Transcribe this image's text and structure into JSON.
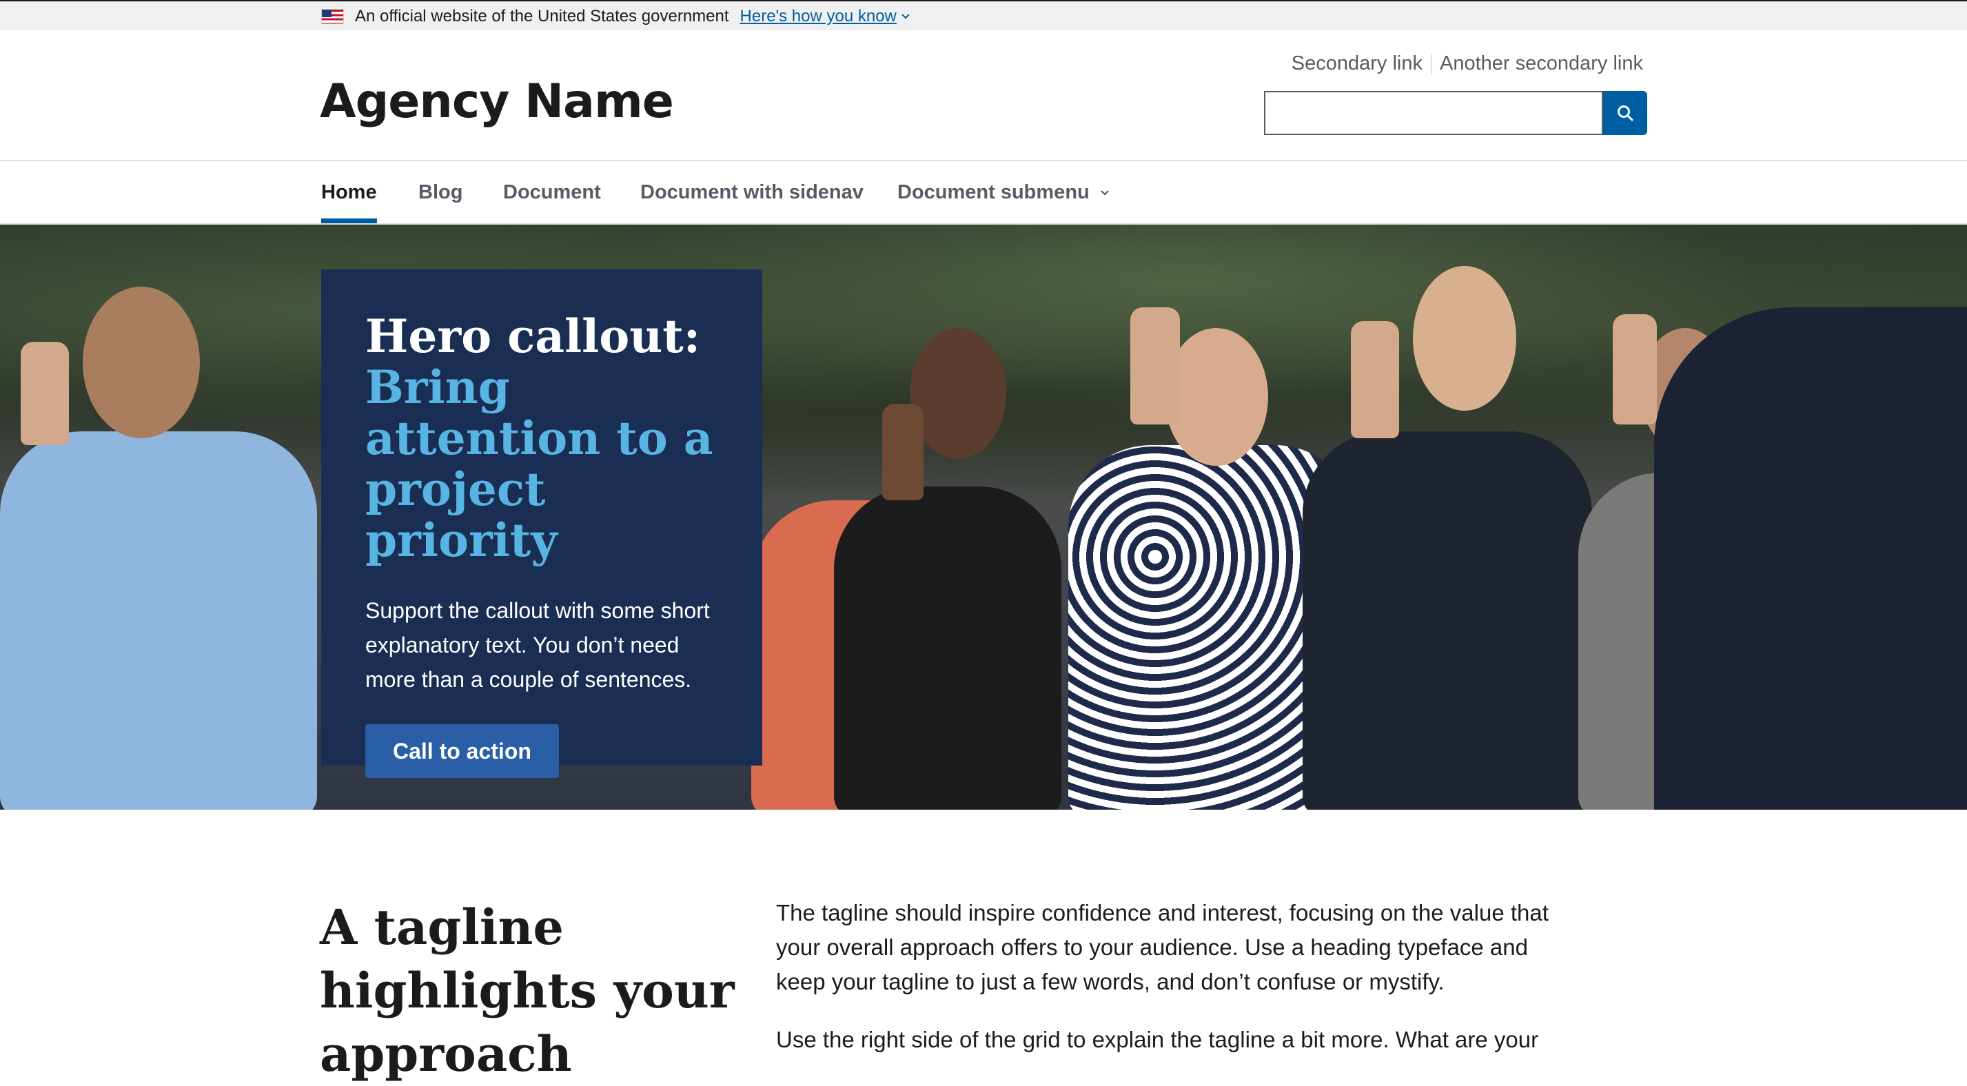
{
  "banner": {
    "text": "An official website of the United States government",
    "link": "Here's how you know"
  },
  "header": {
    "agency_name": "Agency Name",
    "secondary_links": [
      "Secondary link",
      "Another secondary link"
    ],
    "search_placeholder": ""
  },
  "nav": {
    "items": [
      {
        "label": "Home",
        "active": true
      },
      {
        "label": "Blog"
      },
      {
        "label": "Document"
      },
      {
        "label": "Document with sidenav"
      },
      {
        "label": "Document submenu",
        "has_submenu": true
      }
    ]
  },
  "hero": {
    "heading": "Hero callout:",
    "heading_accent": "Bring attention to a project priority",
    "text": "Support the callout with some short explanatory text. You don’t need more than a couple of sentences.",
    "cta": "Call to action"
  },
  "tagline": {
    "heading": "A tagline highlights your approach",
    "paragraphs": [
      "The tagline should inspire confidence and interest, focusing on the value that your overall approach offers to your audience. Use a heading typeface and keep your tagline to just a few words, and don’t confuse or mystify.",
      "Use the right side of the grid to explain the tagline a bit more. What are your"
    ]
  },
  "colors": {
    "primary": "#005ea2",
    "hero_callout_bg": "#1a2e54",
    "accent_cyan": "#58b4e2"
  },
  "icons": [
    "us-flag-icon",
    "chevron-down-icon",
    "search-icon"
  ]
}
